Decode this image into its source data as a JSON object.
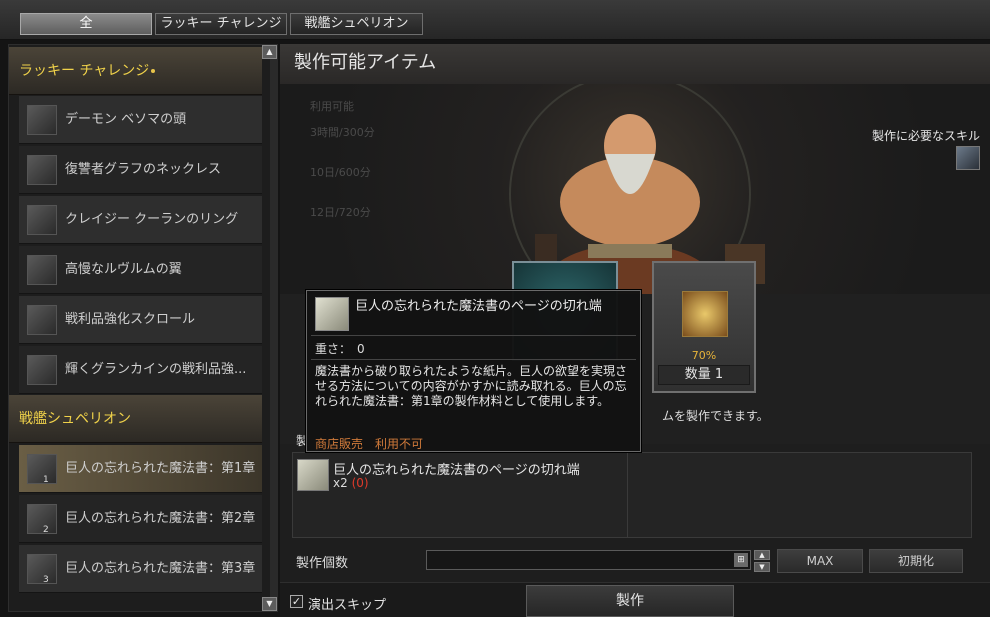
{
  "tabs": [
    {
      "label": "全",
      "active": true
    },
    {
      "label": "ラッキー チャレンジ",
      "active": false
    },
    {
      "label": "戦艦シュペリオン",
      "active": false
    }
  ],
  "left": {
    "categories": [
      {
        "label": "ラッキー チャレンジ"
      },
      {
        "label": "戦艦シュペリオン"
      }
    ],
    "items": [
      {
        "label": "デーモン ベソマの頭",
        "icon": "horn-icon"
      },
      {
        "label": "復讐者グラフのネックレス",
        "icon": "necklace-icon"
      },
      {
        "label": "クレイジー クーランのリング",
        "icon": "ring-icon"
      },
      {
        "label": "高慢なルヴルムの翼",
        "icon": "feather-icon"
      },
      {
        "label": "戦利品強化スクロール",
        "icon": "scroll-icon"
      },
      {
        "label": "輝くグランカインの戦利品強...",
        "icon": "scroll-icon"
      },
      {
        "label": "巨人の忘れられた魔法書：第1章",
        "icon": "book-icon",
        "num": "1"
      },
      {
        "label": "巨人の忘れられた魔法書：第2章",
        "icon": "book-icon",
        "num": "2"
      },
      {
        "label": "巨人の忘れられた魔法書：第3章",
        "icon": "book-icon",
        "num": "3"
      }
    ]
  },
  "right": {
    "header": "製作可能アイテム",
    "ghost": [
      "利用可能",
      "3時間/300分",
      "10日/600分",
      "12日/720分"
    ],
    "skill_label": "製作に必要なスキル",
    "result": {
      "percent": "70%",
      "qty": "数量 1"
    },
    "notice": "ムを製作できます。",
    "materials_label": "製",
    "material": {
      "name": "巨人の忘れられた魔法書のページの切れ端",
      "count": "x2",
      "owned": "(0)"
    },
    "count_label": "製作個数",
    "count_value": "",
    "max_label": "MAX",
    "reset_label": "初期化",
    "skip_label": "演出スキップ",
    "skip_checked": "✓",
    "make_label": "製作"
  },
  "tooltip": {
    "name": "巨人の忘れられた魔法書のページの切れ端",
    "weight": "重さ：　0",
    "desc": "魔法書から破り取られたような紙片。巨人の欲望を実現させる方法についての内容がかすかに読み取れる。巨人の忘れられた魔法書：第1章の製作材料として使用します。",
    "shop": "商店販売　利用不可"
  }
}
